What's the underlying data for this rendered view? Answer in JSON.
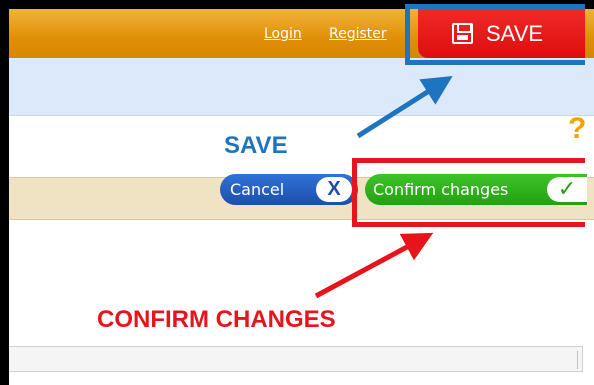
{
  "header": {
    "login_label": "Login",
    "register_label": "Register"
  },
  "toolbar": {
    "save_label": "SAVE",
    "help_label": "?"
  },
  "actions": {
    "cancel_label": "Cancel",
    "cancel_icon_glyph": "X",
    "confirm_label": "Confirm changes",
    "confirm_icon_glyph": "✓"
  },
  "annotations": {
    "save_text": "SAVE",
    "confirm_text": "CONFIRM CHANGES"
  },
  "colors": {
    "header_orange": "#e08f08",
    "save_red": "#dd0d0d",
    "highlight_blue": "#1f74c0",
    "highlight_red": "#e8141b",
    "cancel_blue": "#1d4faa",
    "confirm_green": "#23a012",
    "help_orange": "#f5a300",
    "actionbar_beige": "#efe3c4"
  },
  "icons": {
    "save": "floppy-disk-icon",
    "cancel": "close-icon",
    "confirm": "checkmark-icon",
    "help": "question-mark-icon"
  }
}
